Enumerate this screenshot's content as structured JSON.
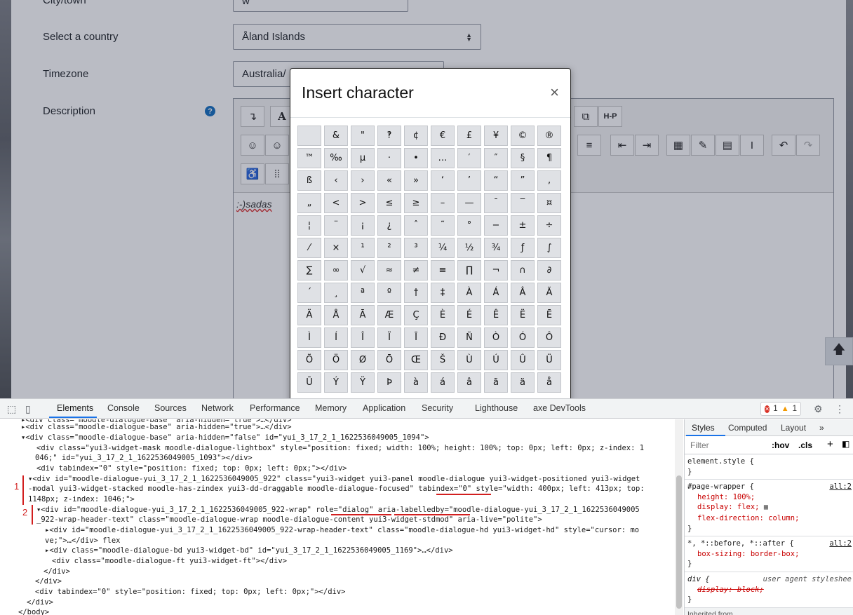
{
  "form": {
    "city_label": "City/town",
    "city_value": "w",
    "country_label": "Select a country",
    "country_value": "Åland Islands",
    "timezone_label": "Timezone",
    "timezone_value": "Australia/",
    "description_label": "Description",
    "help_icon_glyph": "?"
  },
  "editor": {
    "content": ":-)sadas",
    "toolbar_row1": [
      "↴",
      "A",
      "⧉",
      "H-P"
    ],
    "toolbar_row2": [
      "☺",
      "☺",
      "≡",
      "⇤",
      "⇥",
      "▦",
      "✎",
      "▤",
      "I",
      "↶",
      "↷"
    ],
    "toolbar_row3": [
      "♿",
      "⁞⁞"
    ]
  },
  "scroll_top_glyph": "🡅",
  "dialog": {
    "title": "Insert character",
    "close_glyph": "×",
    "characters": [
      " ",
      "&",
      "\"",
      "‽",
      "¢",
      "€",
      "£",
      "¥",
      "©",
      "®",
      "™",
      "‰",
      "µ",
      "·",
      "•",
      "…",
      "′",
      "″",
      "§",
      "¶",
      "ß",
      "‹",
      "›",
      "«",
      "»",
      "‘",
      "’",
      "“",
      "”",
      "‚",
      "„",
      "<",
      ">",
      "≤",
      "≥",
      "–",
      "—",
      "¯",
      "‾",
      "¤",
      "¦",
      "¨",
      "¡",
      "¿",
      "ˆ",
      "˜",
      "°",
      "−",
      "±",
      "÷",
      "⁄",
      "×",
      "¹",
      "²",
      "³",
      "¼",
      "½",
      "¾",
      "ƒ",
      "∫",
      "∑",
      "∞",
      "√",
      "≈",
      "≠",
      "≡",
      "∏",
      "¬",
      "∩",
      "∂",
      "´",
      "¸",
      "ª",
      "º",
      "†",
      "‡",
      "À",
      "Á",
      "Â",
      "Ã",
      "Ä",
      "Å",
      "Ā",
      "Æ",
      "Ç",
      "È",
      "É",
      "Ê",
      "Ë",
      "Ē",
      "Ì",
      "Í",
      "Î",
      "Ï",
      "Ī",
      "Ð",
      "Ñ",
      "Ò",
      "Ó",
      "Ô",
      "Õ",
      "Ö",
      "Ø",
      "Ō",
      "Œ",
      "Š",
      "Ù",
      "Ú",
      "Û",
      "Ü",
      "Ū",
      "Ý",
      "Ÿ",
      "Þ",
      "à",
      "á",
      "â",
      "ã",
      "ä",
      "å"
    ]
  },
  "devtools": {
    "tabs": [
      "Elements",
      "Console",
      "Sources",
      "Network",
      "Performance",
      "Memory",
      "Application",
      "Security",
      "Lighthouse",
      "axe DevTools"
    ],
    "active_tab": "Elements",
    "errors": "1",
    "warnings": "1",
    "markers": [
      "1",
      "2"
    ],
    "elements_lines": [
      "▸<div class=\"moodle-dialogue-base\" aria-hidden=\"true\">…</div>",
      "▸<div class=\"moodle-dialogue-base\" aria-hidden=\"true\">…</div>",
      "▾<div class=\"moodle-dialogue-base\" aria-hidden=\"false\" id=\"yui_3_17_2_1_1622536049005_1094\">",
      "<div class=\"yui3-widget-mask moodle-dialogue-lightbox\" style=\"position: fixed; width: 100%; height: 100%; top: 0px; left: 0px; z-index: 1",
      "046;\" id=\"yui_3_17_2_1_1622536049005_1093\"></div>",
      "<div tabindex=\"0\" style=\"position: fixed; top: 0px; left: 0px;\"></div>",
      "▾<div id=\"moodle-dialogue-yui_3_17_2_1_1622536049005_922\" class=\"yui3-widget yui3-panel moodle-dialogue yui3-widget-positioned yui3-widget",
      "-modal yui3-widget-stacked moodle-has-zindex yui3-dd-draggable moodle-dialogue-focused\" tabindex=\"0\" style=\"width: 400px; left: 413px; top:",
      "1148px; z-index: 1046;\">",
      "▾<div id=\"moodle-dialogue-yui_3_17_2_1_1622536049005_922-wrap\" role=\"dialog\" aria-labelledby=\"moodle-dialogue-yui_3_17_2_1_1622536049005",
      "_922-wrap-header-text\" class=\"moodle-dialogue-wrap moodle-dialogue-content yui3-widget-stdmod\" aria-live=\"polite\">",
      "▸<div id=\"moodle-dialogue-yui_3_17_2_1_1622536049005_922-wrap-header-text\" class=\"moodle-dialogue-hd yui3-widget-hd\" style=\"cursor: mo",
      "ve;\">…</div> flex",
      "▸<div class=\"moodle-dialogue-bd yui3-widget-bd\" id=\"yui_3_17_2_1_1622536049005_1169\">…</div>",
      "<div class=\"moodle-dialogue-ft yui3-widget-ft\"></div>",
      "</div>",
      "</div>",
      "<div tabindex=\"0\" style=\"position: fixed; top: 0px; left: 0px;\"></div>",
      "</div>",
      "</body>"
    ],
    "styles_tabs": [
      "Styles",
      "Computed",
      "Layout",
      "»"
    ],
    "filter_placeholder": "Filter",
    "filter_hov": ":hov",
    "filter_cls": ".cls",
    "rules": {
      "element_style": "element.style {",
      "page_wrapper_selector": "#page-wrapper {",
      "page_wrapper_source": "all:2",
      "page_wrapper_props": [
        "height: 100%;",
        "display: flex;",
        "flex-direction: column;"
      ],
      "universal_selector": "*, *::before, *::after {",
      "universal_source": "all:2",
      "universal_props": [
        "box-sizing: border-box;"
      ],
      "div_selector": "div {",
      "div_source": "user agent styleshee",
      "div_props": [
        "display: block;"
      ],
      "close_brace": "}",
      "inherited": "Inherited from"
    }
  }
}
